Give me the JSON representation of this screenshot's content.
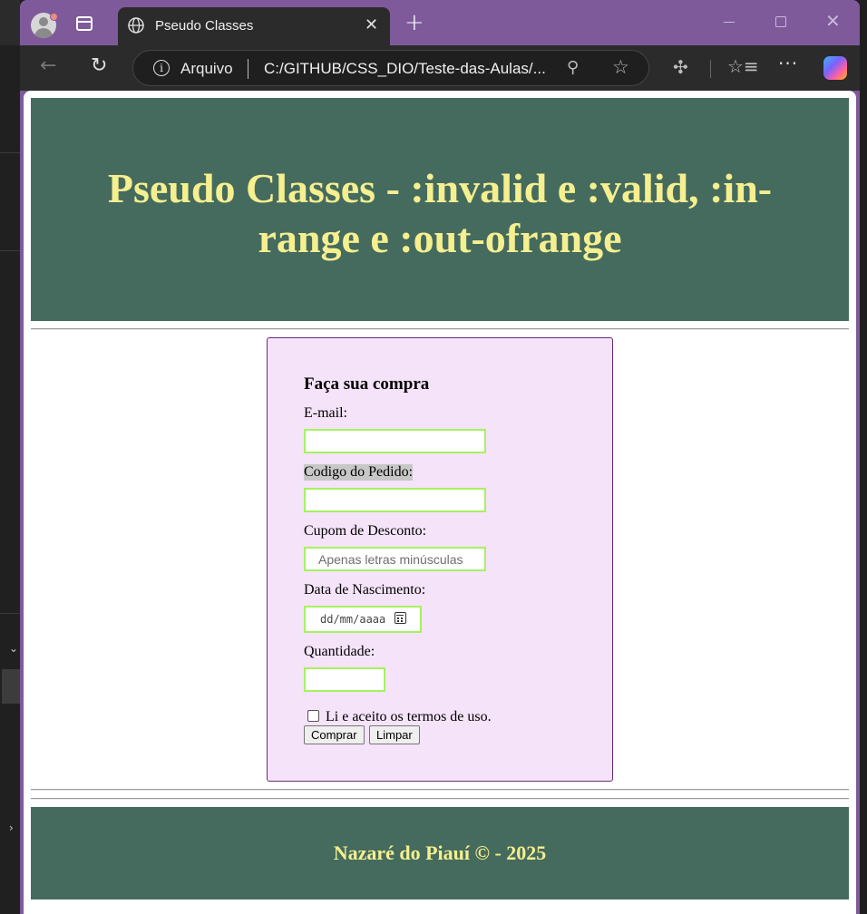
{
  "browser": {
    "tab_title": "Pseudo Classes",
    "new_tab_symbol": "+",
    "close_symbol": "✕",
    "address_label": "Arquivo",
    "url": "C:/GITHUB/CSS_DIO/Teste-das-Aulas/...",
    "accent_color": "#7e5a9b"
  },
  "header": {
    "title": "Pseudo Classes - :invalid e :valid, :in-range e :out-ofrange"
  },
  "form": {
    "heading": "Faça sua compra",
    "email_label": "E-mail:",
    "email_value": "",
    "order_label": "Codigo do Pedido:",
    "order_value": "",
    "coupon_label": "Cupom de Desconto:",
    "coupon_placeholder": "Apenas letras minúsculas",
    "birth_label": "Data de Nascimento:",
    "birth_placeholder": "dd/mm/aaaa",
    "quantity_label": "Quantidade:",
    "quantity_value": "",
    "terms_label": "Li e aceito os termos de uso.",
    "submit_label": "Comprar",
    "reset_label": "Limpar",
    "valid_border_color": "#a5f25f",
    "box_color": "#f5e3f9"
  },
  "footer": {
    "text": "Nazaré do Piauí © - 2025"
  },
  "colors": {
    "header_bg": "#456b5e",
    "header_text": "#f5ef8f"
  }
}
